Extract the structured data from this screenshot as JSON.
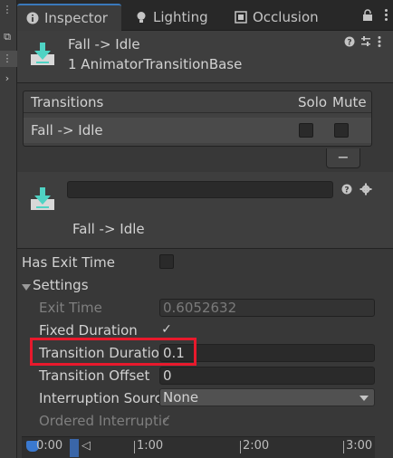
{
  "tabs": [
    {
      "label": "Inspector",
      "icon": "info-icon",
      "active": true
    },
    {
      "label": "Lighting",
      "icon": "lightbulb-icon",
      "active": false
    },
    {
      "label": "Occlusion",
      "icon": "occlusion-icon",
      "active": false
    }
  ],
  "header": {
    "title": "Fall -> Idle",
    "subtitle": "1 AnimatorTransitionBase"
  },
  "transitions": {
    "heading": "Transitions",
    "solo_label": "Solo",
    "mute_label": "Mute",
    "rows": [
      {
        "name": "Fall -> Idle",
        "solo": false,
        "mute": false
      }
    ],
    "remove_label": "−"
  },
  "transition": {
    "name_value": "",
    "title": "Fall -> Idle"
  },
  "properties": {
    "has_exit_time": {
      "label": "Has Exit Time",
      "checked": false
    },
    "settings_label": "Settings",
    "exit_time": {
      "label": "Exit Time",
      "value": "0.6052632"
    },
    "fixed_duration": {
      "label": "Fixed Duration",
      "checked": true
    },
    "transition_duration": {
      "label": "Transition Duratio",
      "value": "0.1"
    },
    "transition_offset": {
      "label": "Transition Offset",
      "value": "0"
    },
    "interruption_source": {
      "label": "Interruption Sourc",
      "value": "None"
    },
    "ordered_interruption": {
      "label": "Ordered Interruptic",
      "checked": true
    }
  },
  "timeline": {
    "labels": [
      "0:00",
      "1:00",
      "2:00",
      "3:00"
    ]
  },
  "colors": {
    "accent": "#3a79bb",
    "highlight": "#e8192c",
    "icon_teal": "#4fd3c4"
  }
}
